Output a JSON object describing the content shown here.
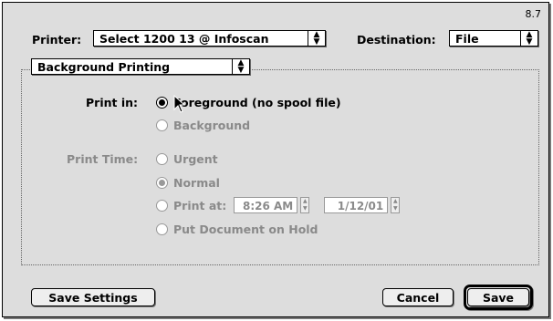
{
  "version": "8.7",
  "printer": {
    "label": "Printer:",
    "value": "Select 1200 13 @ Infoscan"
  },
  "destination": {
    "label": "Destination:",
    "value": "File"
  },
  "section_popup": {
    "value": "Background Printing"
  },
  "print_in": {
    "label": "Print in:",
    "options": [
      {
        "label": "Foreground (no spool file)",
        "selected": true,
        "enabled": true
      },
      {
        "label": "Background",
        "selected": false,
        "enabled": false
      }
    ]
  },
  "print_time": {
    "label": "Print Time:",
    "options": [
      {
        "label": "Urgent",
        "selected": false
      },
      {
        "label": "Normal",
        "selected": true
      },
      {
        "label": "Print at:",
        "selected": false
      },
      {
        "label": "Put Document on Hold",
        "selected": false
      }
    ],
    "time_value": "8:26 AM",
    "date_value": "1/12/01"
  },
  "buttons": {
    "save_settings": "Save Settings",
    "cancel": "Cancel",
    "save": "Save"
  },
  "colors": {
    "dialog_bg": "#dddddd",
    "disabled_text": "#8a8a8a"
  }
}
